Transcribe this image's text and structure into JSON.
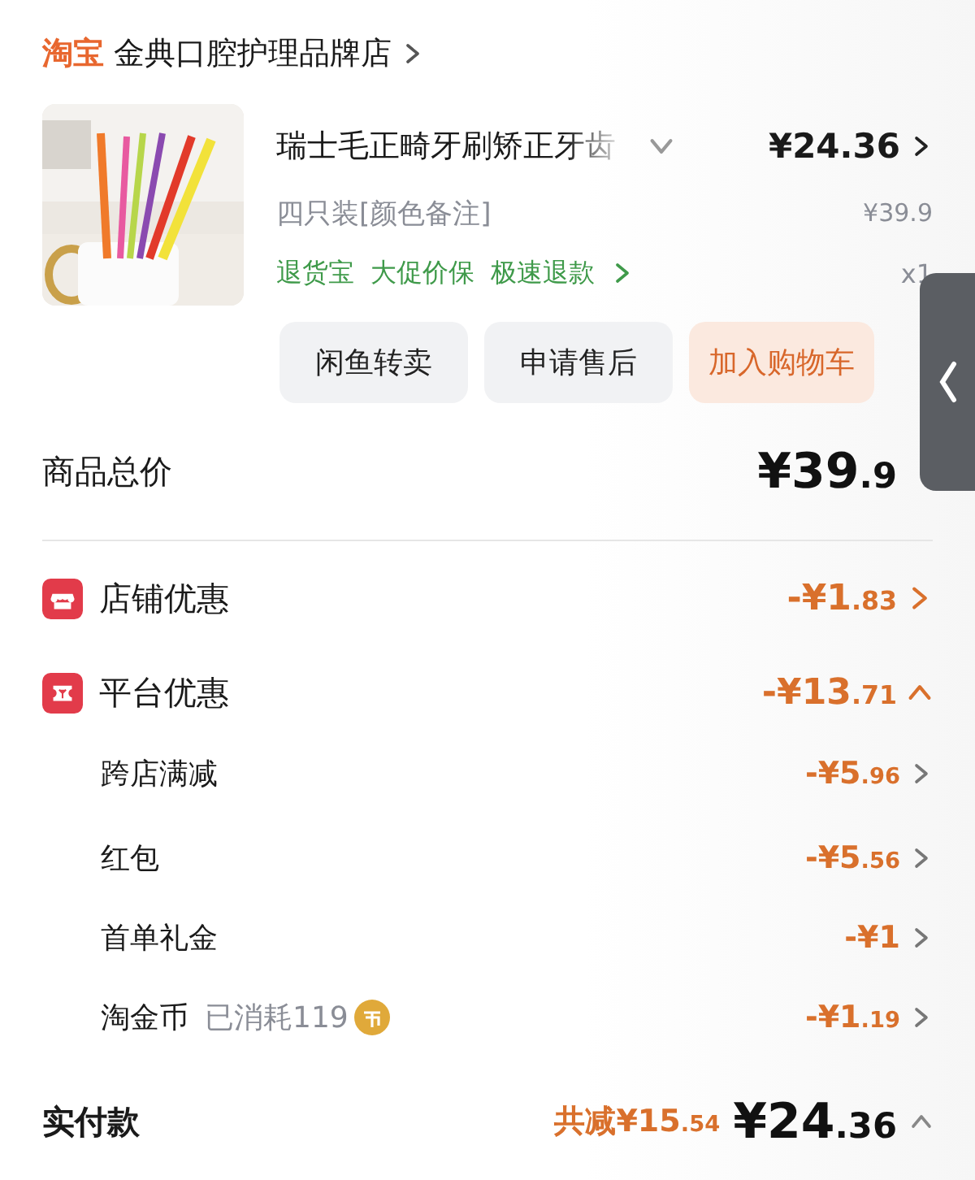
{
  "header": {
    "brand": "淘宝",
    "shop": "金典口腔护理品牌店"
  },
  "item": {
    "image": {
      "kind": "picture"
    },
    "title": "瑞士毛正畸牙刷矫正牙齿",
    "price": "¥24.36",
    "variant": "四只装[颜色备注]",
    "original_price": "¥39.9",
    "services": [
      "退货宝",
      "大促价保",
      "极速退款"
    ],
    "quantity": "x1"
  },
  "actions": [
    {
      "label": "闲鱼转卖",
      "kind": "plain"
    },
    {
      "label": "申请售后",
      "kind": "plain"
    },
    {
      "label": "加入购物车",
      "kind": "accent"
    }
  ],
  "total": {
    "label": "商品总价",
    "amount": "¥39.9"
  },
  "discounts": [
    {
      "kind": "shop",
      "label": "店铺优惠",
      "amount": "-¥1.83",
      "expanded": false
    },
    {
      "kind": "platform",
      "label": "平台优惠",
      "amount": "-¥13.71",
      "expanded": true,
      "children": [
        {
          "label": "跨店满减",
          "amount": "-¥5.96"
        },
        {
          "label": "红包",
          "amount": "-¥5.56"
        },
        {
          "label": "首单礼金",
          "amount": "-¥1"
        },
        {
          "label": "淘金币",
          "note": "已消耗119",
          "amount": "-¥1.19"
        }
      ]
    }
  ],
  "payment": {
    "label": "实付款",
    "saved": "共减¥15.54",
    "amount": "¥24.36",
    "expanded": true
  }
}
